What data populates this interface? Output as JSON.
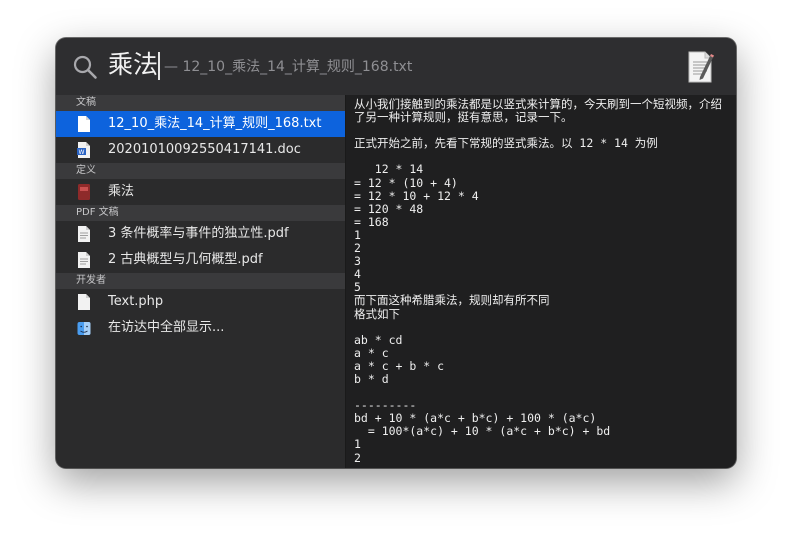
{
  "search": {
    "query": "乘法",
    "suggestion": "— 12_10_乘法_14_计算_规则_168.txt"
  },
  "sections": [
    {
      "header": "文稿"
    },
    {
      "header": "定义"
    },
    {
      "header": "PDF 文稿"
    },
    {
      "header": "开发者"
    }
  ],
  "results": [
    {
      "label": "12_10_乘法_14_计算_规则_168.txt",
      "icon": "text-file-icon",
      "selected": true
    },
    {
      "label": "20201010092550417141.doc",
      "icon": "word-doc-icon",
      "selected": false
    },
    {
      "label": "乘法",
      "icon": "dictionary-icon",
      "selected": false
    },
    {
      "label": "3 条件概率与事件的独立性.pdf",
      "icon": "pdf-file-icon",
      "selected": false
    },
    {
      "label": "2 古典概型与几何概型.pdf",
      "icon": "pdf-file-icon",
      "selected": false
    },
    {
      "label": "Text.php",
      "icon": "text-file-icon",
      "selected": false
    },
    {
      "label": "在访达中全部显示...",
      "icon": "finder-icon",
      "selected": false
    }
  ],
  "preview": {
    "lines": [
      "从小我们接触到的乘法都是以竖式来计算的，今天刷到一个短视频，介绍了另一种计算规则，挺有意思，记录一下。",
      "",
      "正式开始之前，先看下常规的竖式乘法。以 12 * 14 为例",
      "",
      "   12 * 14",
      "= 12 * (10 + 4)",
      "= 12 * 10 + 12 * 4",
      "= 120 * 48",
      "= 168",
      "1",
      "2",
      "3",
      "4",
      "5",
      "而下面这种希腊乘法，规则却有所不同",
      "格式如下",
      "",
      "ab * cd",
      "a * c",
      "a * c + b * c",
      "b * d",
      "",
      "---------",
      "bd + 10 * (a*c + b*c) + 100 * (a*c)",
      "  = 100*(a*c) + 10 * (a*c + b*c) + bd",
      "1",
      "2"
    ]
  },
  "colors": {
    "selection": "#0d63dd",
    "window_bg": "#2b2b2c",
    "preview_bg": "#1f1f20",
    "section_header_bg": "#3a3a3c"
  }
}
